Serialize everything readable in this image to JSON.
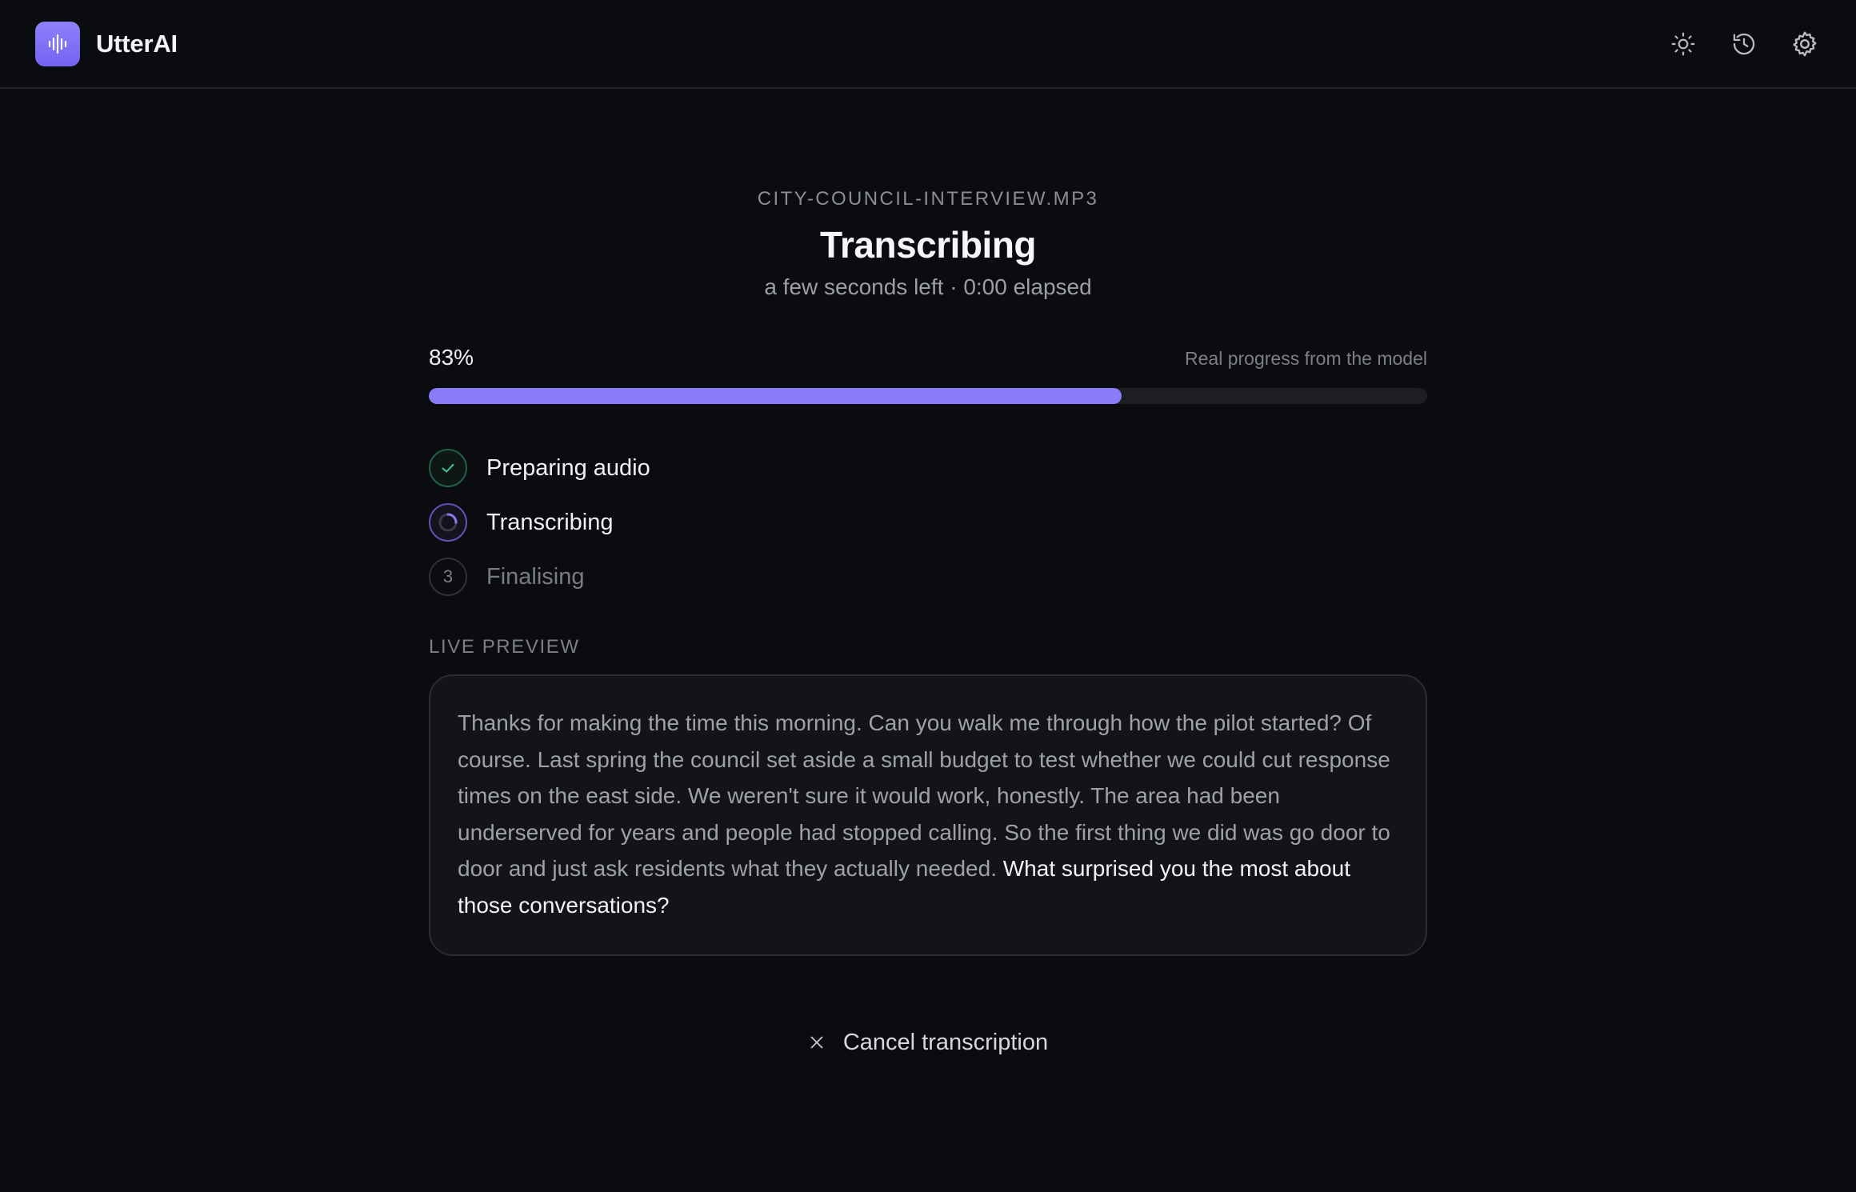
{
  "app": {
    "name": "UtterAI",
    "accent": "#8a7cf9"
  },
  "header": {
    "actions": [
      {
        "icon": "sun-icon"
      },
      {
        "icon": "history-icon"
      },
      {
        "icon": "gear-icon"
      }
    ]
  },
  "job": {
    "file_name": "CITY-COUNCIL-INTERVIEW.MP3",
    "title": "Transcribing",
    "status_line": "a few seconds left · 0:00 elapsed",
    "progress_label": "83%",
    "progress_value": 0.694,
    "progress_note": "Real progress from the model"
  },
  "steps": [
    {
      "label": "Preparing audio",
      "state": "done"
    },
    {
      "label": "Transcribing",
      "state": "active"
    },
    {
      "label": "Finalising",
      "state": "pending",
      "number": "3"
    }
  ],
  "preview": {
    "section_label": "LIVE PREVIEW",
    "committed_text": "Thanks for making the time this morning. Can you walk me through how the pilot started? Of course. Last spring the council set aside a small budget to test whether we could cut response times on the east side. We weren't sure it would work, honestly. The area had been underserved for years and people had stopped calling. So the first thing we did was go door to door and just ask residents what they actually needed.",
    "live_text": "What surprised you the most about those conversations?"
  },
  "cancel": {
    "label": "Cancel transcription"
  }
}
